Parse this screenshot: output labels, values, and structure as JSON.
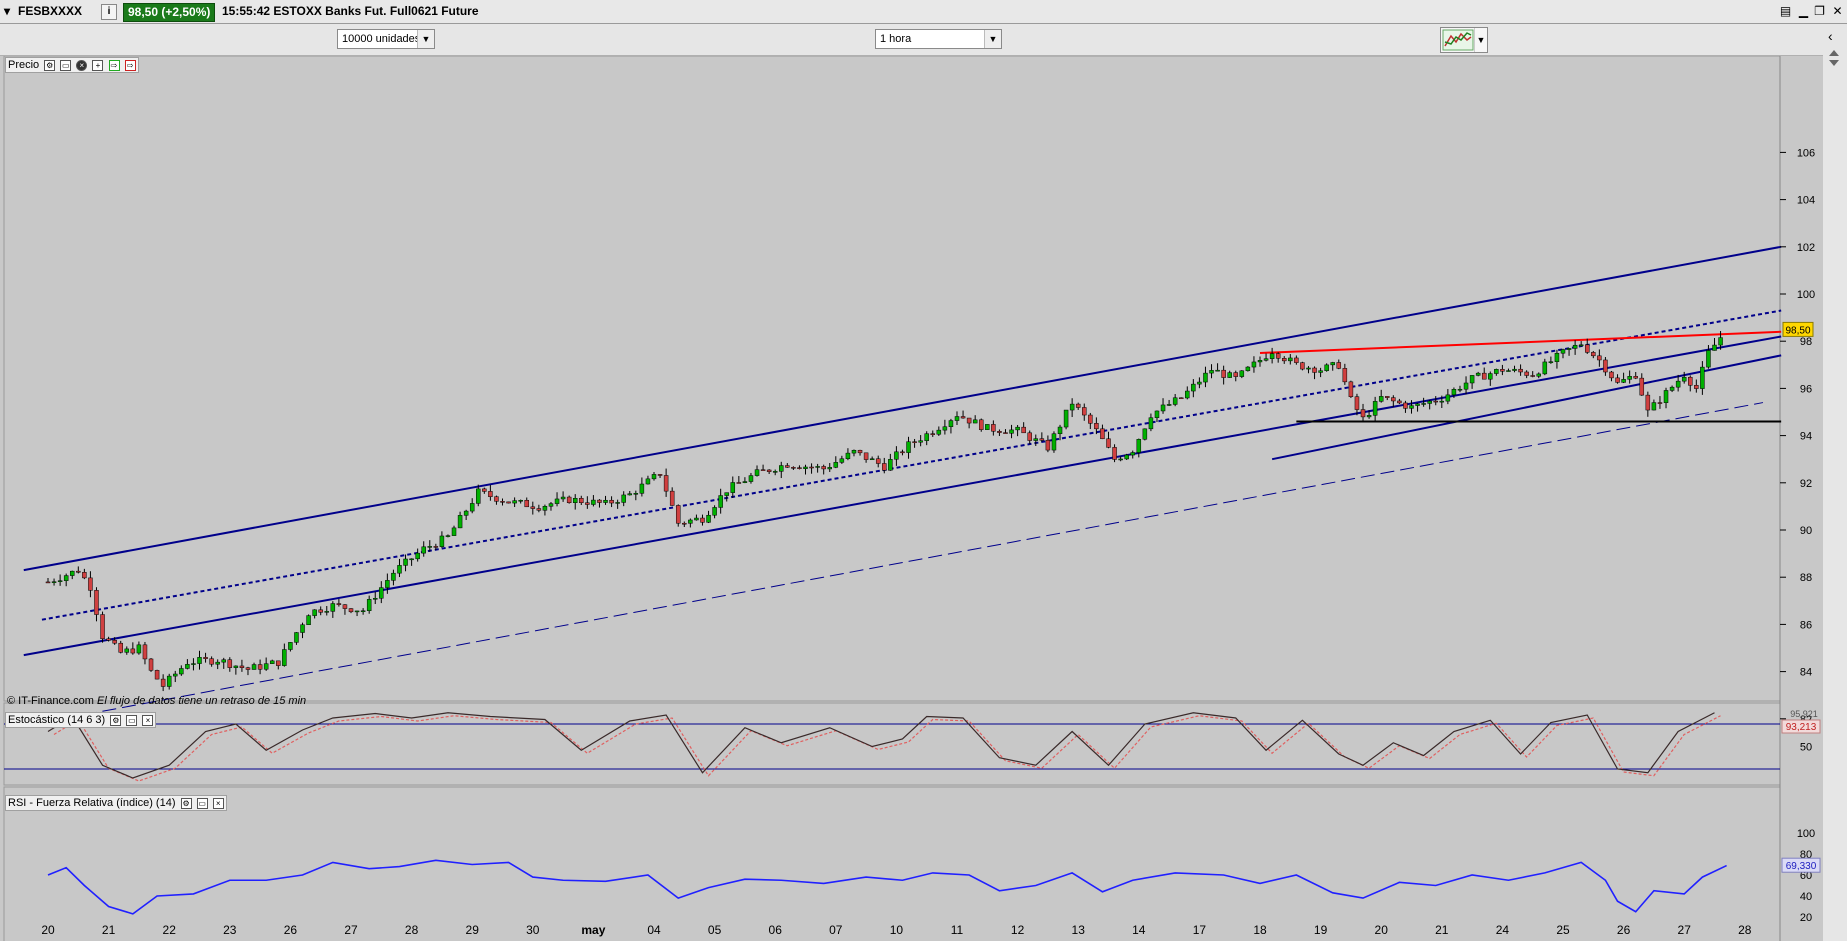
{
  "window": {
    "symbol": "FESBXXXX",
    "price_badge": "98,50 (+2,50%)",
    "info_icon": "info-icon",
    "title": "15:55:42 ESTOXX Banks Fut. Full0621 Future"
  },
  "toolbar": {
    "units_select": "10000 unidades",
    "interval_select": "1 hora",
    "chart_type_icon": "candlestick-chart-icon"
  },
  "panels": {
    "price": {
      "label": "Precio",
      "last_price_tag": "98,50"
    },
    "stochastic": {
      "label": "Estocástico (14 6 3)",
      "value_tag_top": "95,921",
      "value_tag": "93,213"
    },
    "rsi": {
      "label": "RSI - Fuerza Relativa (índice) (14)",
      "value_tag": "69,330"
    }
  },
  "footer": {
    "copyright": "© IT-Finance.com",
    "delay_note": "El flujo de datos tiene un retraso de 15 min"
  },
  "colors": {
    "background": "#c8c8c8",
    "channel_line": "#00008b",
    "resistance_line": "#ff0000",
    "support_line": "#000000",
    "candle_up": "#00b000",
    "candle_down": "#d04040",
    "rsi_line": "#2020ff",
    "price_tag": "#ffd700"
  },
  "chart_data": [
    {
      "type": "candlestick",
      "title": "Precio",
      "x_tick_labels": [
        "20",
        "21",
        "22",
        "23",
        "26",
        "27",
        "28",
        "29",
        "30",
        "may",
        "04",
        "05",
        "06",
        "07",
        "10",
        "11",
        "12",
        "13",
        "14",
        "17",
        "18",
        "19",
        "20",
        "21",
        "24",
        "25",
        "26",
        "27",
        "28"
      ],
      "y_ticks": [
        82,
        84,
        86,
        88,
        90,
        92,
        94,
        96,
        98,
        100,
        102,
        104,
        106
      ],
      "ylim": [
        80.5,
        107.5
      ],
      "last_price": 98.5,
      "close_path": [
        {
          "x": 0,
          "y": 87.8
        },
        {
          "x": 0.5,
          "y": 88.3
        },
        {
          "x": 0.7,
          "y": 87.6
        },
        {
          "x": 0.9,
          "y": 85.5
        },
        {
          "x": 1.2,
          "y": 84.8
        },
        {
          "x": 1.5,
          "y": 85.0
        },
        {
          "x": 1.7,
          "y": 84.0
        },
        {
          "x": 1.9,
          "y": 83.4
        },
        {
          "x": 2.3,
          "y": 84.4
        },
        {
          "x": 2.8,
          "y": 84.5
        },
        {
          "x": 3.3,
          "y": 84.1
        },
        {
          "x": 3.8,
          "y": 84.4
        },
        {
          "x": 4.3,
          "y": 86.5
        },
        {
          "x": 4.7,
          "y": 86.8
        },
        {
          "x": 5.2,
          "y": 86.6
        },
        {
          "x": 5.7,
          "y": 88.2
        },
        {
          "x": 6.2,
          "y": 89.2
        },
        {
          "x": 6.6,
          "y": 89.7
        },
        {
          "x": 7.1,
          "y": 91.6
        },
        {
          "x": 7.6,
          "y": 91.2
        },
        {
          "x": 8.1,
          "y": 91.0
        },
        {
          "x": 8.6,
          "y": 91.3
        },
        {
          "x": 9.2,
          "y": 91.1
        },
        {
          "x": 9.6,
          "y": 91.5
        },
        {
          "x": 10.1,
          "y": 92.4
        },
        {
          "x": 10.4,
          "y": 90.3
        },
        {
          "x": 10.8,
          "y": 90.5
        },
        {
          "x": 11.2,
          "y": 91.7
        },
        {
          "x": 11.7,
          "y": 92.4
        },
        {
          "x": 12.2,
          "y": 92.8
        },
        {
          "x": 12.8,
          "y": 92.6
        },
        {
          "x": 13.3,
          "y": 93.3
        },
        {
          "x": 13.8,
          "y": 92.7
        },
        {
          "x": 14.2,
          "y": 93.6
        },
        {
          "x": 14.6,
          "y": 94.2
        },
        {
          "x": 15.0,
          "y": 94.9
        },
        {
          "x": 15.5,
          "y": 94.3
        },
        {
          "x": 16.0,
          "y": 94.2
        },
        {
          "x": 16.5,
          "y": 93.5
        },
        {
          "x": 16.9,
          "y": 95.4
        },
        {
          "x": 17.3,
          "y": 94.2
        },
        {
          "x": 17.6,
          "y": 93.0
        },
        {
          "x": 17.9,
          "y": 93.4
        },
        {
          "x": 18.2,
          "y": 94.9
        },
        {
          "x": 18.7,
          "y": 95.6
        },
        {
          "x": 19.2,
          "y": 96.8
        },
        {
          "x": 19.6,
          "y": 96.4
        },
        {
          "x": 19.9,
          "y": 97.0
        },
        {
          "x": 20.2,
          "y": 97.6
        },
        {
          "x": 20.6,
          "y": 97.0
        },
        {
          "x": 21.0,
          "y": 96.8
        },
        {
          "x": 21.3,
          "y": 97.0
        },
        {
          "x": 21.5,
          "y": 95.5
        },
        {
          "x": 21.7,
          "y": 94.7
        },
        {
          "x": 22.0,
          "y": 95.6
        },
        {
          "x": 22.5,
          "y": 95.2
        },
        {
          "x": 23.0,
          "y": 95.6
        },
        {
          "x": 23.5,
          "y": 96.4
        },
        {
          "x": 24.0,
          "y": 96.8
        },
        {
          "x": 24.5,
          "y": 96.6
        },
        {
          "x": 25.0,
          "y": 97.5
        },
        {
          "x": 25.3,
          "y": 97.9
        },
        {
          "x": 25.6,
          "y": 97.2
        },
        {
          "x": 25.9,
          "y": 96.2
        },
        {
          "x": 26.2,
          "y": 96.6
        },
        {
          "x": 26.4,
          "y": 95.0
        },
        {
          "x": 26.7,
          "y": 95.8
        },
        {
          "x": 27.0,
          "y": 96.6
        },
        {
          "x": 27.2,
          "y": 96.0
        },
        {
          "x": 27.4,
          "y": 97.5
        },
        {
          "x": 27.7,
          "y": 98.5
        }
      ],
      "trendlines": [
        {
          "name": "channel-upper",
          "x": [
            -0.4,
            28.6
          ],
          "y": [
            88.3,
            102.0
          ]
        },
        {
          "name": "channel-middle-dotted",
          "x": [
            -0.1,
            28.6
          ],
          "y": [
            86.2,
            99.3
          ]
        },
        {
          "name": "channel-lower",
          "x": [
            -0.4,
            28.6
          ],
          "y": [
            84.7,
            98.2
          ]
        },
        {
          "name": "secondary-lower",
          "x": [
            20.2,
            28.6
          ],
          "y": [
            93.0,
            97.4
          ]
        },
        {
          "name": "long-dashed",
          "x": [
            -0.4,
            28.3
          ],
          "y": [
            81.7,
            95.4
          ]
        },
        {
          "name": "resistance-red",
          "x": [
            20.0,
            28.6
          ],
          "y": [
            97.5,
            98.4
          ]
        },
        {
          "name": "support-black",
          "x": [
            20.6,
            28.6
          ],
          "y": [
            94.6,
            94.6
          ]
        }
      ]
    },
    {
      "type": "line",
      "title": "Estocástico (14 6 3)",
      "y_ticks": [
        50
      ],
      "levels": [
        80,
        20
      ],
      "ylim": [
        0,
        100
      ],
      "path": [
        {
          "x": 0,
          "y": 70
        },
        {
          "x": 0.4,
          "y": 90
        },
        {
          "x": 0.9,
          "y": 25
        },
        {
          "x": 1.4,
          "y": 8
        },
        {
          "x": 2.0,
          "y": 25
        },
        {
          "x": 2.6,
          "y": 70
        },
        {
          "x": 3.1,
          "y": 80
        },
        {
          "x": 3.6,
          "y": 45
        },
        {
          "x": 4.2,
          "y": 72
        },
        {
          "x": 4.7,
          "y": 88
        },
        {
          "x": 5.4,
          "y": 94
        },
        {
          "x": 6.0,
          "y": 88
        },
        {
          "x": 6.6,
          "y": 95
        },
        {
          "x": 7.3,
          "y": 90
        },
        {
          "x": 8.2,
          "y": 86
        },
        {
          "x": 8.8,
          "y": 45
        },
        {
          "x": 9.6,
          "y": 84
        },
        {
          "x": 10.2,
          "y": 92
        },
        {
          "x": 10.8,
          "y": 15
        },
        {
          "x": 11.5,
          "y": 75
        },
        {
          "x": 12.1,
          "y": 55
        },
        {
          "x": 12.9,
          "y": 75
        },
        {
          "x": 13.6,
          "y": 50
        },
        {
          "x": 14.1,
          "y": 60
        },
        {
          "x": 14.5,
          "y": 90
        },
        {
          "x": 15.1,
          "y": 88
        },
        {
          "x": 15.7,
          "y": 35
        },
        {
          "x": 16.3,
          "y": 25
        },
        {
          "x": 16.9,
          "y": 70
        },
        {
          "x": 17.5,
          "y": 25
        },
        {
          "x": 18.1,
          "y": 80
        },
        {
          "x": 18.9,
          "y": 95
        },
        {
          "x": 19.6,
          "y": 88
        },
        {
          "x": 20.1,
          "y": 45
        },
        {
          "x": 20.7,
          "y": 85
        },
        {
          "x": 21.3,
          "y": 40
        },
        {
          "x": 21.7,
          "y": 25
        },
        {
          "x": 22.2,
          "y": 55
        },
        {
          "x": 22.7,
          "y": 38
        },
        {
          "x": 23.2,
          "y": 70
        },
        {
          "x": 23.8,
          "y": 85
        },
        {
          "x": 24.3,
          "y": 40
        },
        {
          "x": 24.8,
          "y": 82
        },
        {
          "x": 25.4,
          "y": 92
        },
        {
          "x": 25.9,
          "y": 20
        },
        {
          "x": 26.4,
          "y": 15
        },
        {
          "x": 26.9,
          "y": 70
        },
        {
          "x": 27.5,
          "y": 95
        }
      ]
    },
    {
      "type": "line",
      "title": "RSI - Fuerza Relativa (índice) (14)",
      "y_ticks": [
        20,
        40,
        60,
        80,
        100
      ],
      "ylim": [
        0,
        110
      ],
      "path": [
        {
          "x": 0,
          "y": 60
        },
        {
          "x": 0.3,
          "y": 67
        },
        {
          "x": 0.6,
          "y": 50
        },
        {
          "x": 1.0,
          "y": 30
        },
        {
          "x": 1.4,
          "y": 23
        },
        {
          "x": 1.8,
          "y": 40
        },
        {
          "x": 2.4,
          "y": 42
        },
        {
          "x": 3.0,
          "y": 55
        },
        {
          "x": 3.6,
          "y": 55
        },
        {
          "x": 4.2,
          "y": 60
        },
        {
          "x": 4.7,
          "y": 72
        },
        {
          "x": 5.3,
          "y": 66
        },
        {
          "x": 5.8,
          "y": 68
        },
        {
          "x": 6.4,
          "y": 74
        },
        {
          "x": 7.0,
          "y": 70
        },
        {
          "x": 7.6,
          "y": 72
        },
        {
          "x": 8.0,
          "y": 58
        },
        {
          "x": 8.5,
          "y": 55
        },
        {
          "x": 9.2,
          "y": 54
        },
        {
          "x": 9.9,
          "y": 60
        },
        {
          "x": 10.4,
          "y": 38
        },
        {
          "x": 10.9,
          "y": 48
        },
        {
          "x": 11.5,
          "y": 56
        },
        {
          "x": 12.1,
          "y": 55
        },
        {
          "x": 12.8,
          "y": 52
        },
        {
          "x": 13.5,
          "y": 58
        },
        {
          "x": 14.1,
          "y": 55
        },
        {
          "x": 14.6,
          "y": 62
        },
        {
          "x": 15.2,
          "y": 60
        },
        {
          "x": 15.7,
          "y": 45
        },
        {
          "x": 16.3,
          "y": 50
        },
        {
          "x": 16.9,
          "y": 62
        },
        {
          "x": 17.4,
          "y": 44
        },
        {
          "x": 17.9,
          "y": 55
        },
        {
          "x": 18.6,
          "y": 62
        },
        {
          "x": 19.4,
          "y": 60
        },
        {
          "x": 20.0,
          "y": 52
        },
        {
          "x": 20.6,
          "y": 60
        },
        {
          "x": 21.2,
          "y": 43
        },
        {
          "x": 21.7,
          "y": 38
        },
        {
          "x": 22.3,
          "y": 53
        },
        {
          "x": 22.9,
          "y": 50
        },
        {
          "x": 23.5,
          "y": 60
        },
        {
          "x": 24.1,
          "y": 55
        },
        {
          "x": 24.7,
          "y": 62
        },
        {
          "x": 25.3,
          "y": 72
        },
        {
          "x": 25.7,
          "y": 55
        },
        {
          "x": 25.9,
          "y": 35
        },
        {
          "x": 26.2,
          "y": 25
        },
        {
          "x": 26.5,
          "y": 45
        },
        {
          "x": 27.0,
          "y": 42
        },
        {
          "x": 27.3,
          "y": 58
        },
        {
          "x": 27.7,
          "y": 69
        }
      ]
    }
  ]
}
